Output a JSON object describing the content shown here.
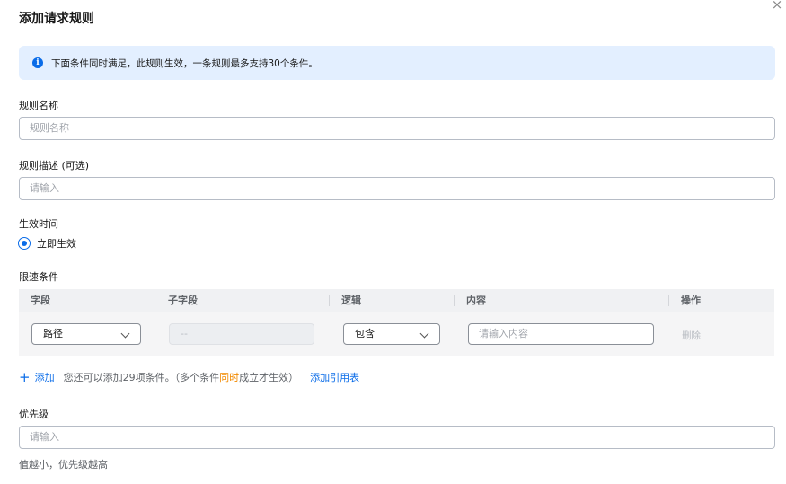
{
  "dialog": {
    "title": "添加请求规则",
    "close_glyph": "×"
  },
  "notice": {
    "icon": "info-icon",
    "text": "下面条件同时满足，此规则生效，一条规则最多支持30个条件。"
  },
  "form": {
    "rule_name": {
      "label": "规则名称",
      "placeholder": "规则名称"
    },
    "rule_desc": {
      "label": "规则描述 (可选)",
      "placeholder": "请输入"
    },
    "effective_time": {
      "label": "生效时间",
      "option": "立即生效",
      "selected": true
    },
    "conditions": {
      "label": "限速条件",
      "columns": [
        "字段",
        "子字段",
        "逻辑",
        "内容",
        "操作"
      ],
      "rows": [
        {
          "field": "路径",
          "subfield": "--",
          "logic": "包含",
          "content_placeholder": "请输入内容",
          "action": "删除"
        }
      ],
      "add_label": "添加",
      "hint_prefix": "您还可以添加29项条件。（多个条件",
      "hint_highlight": "同时",
      "hint_suffix": "成立才生效）",
      "reference_link": "添加引用表"
    },
    "priority": {
      "label": "优先级",
      "placeholder": "请输入",
      "help": "值越小，优先级越高"
    }
  },
  "colors": {
    "accent": "#0a6ce8",
    "notice_bg": "#e3efff",
    "highlight": "#f28a00"
  }
}
